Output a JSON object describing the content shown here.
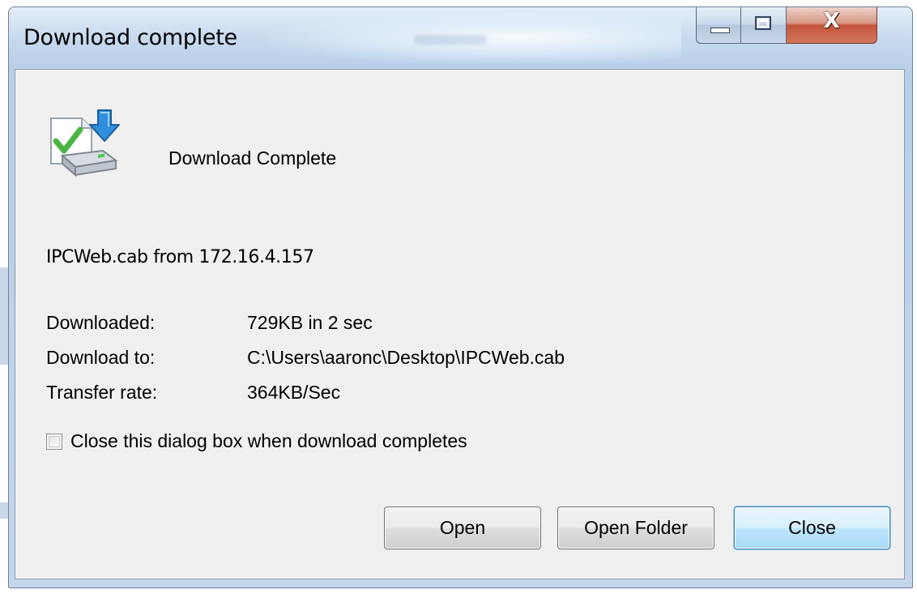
{
  "window": {
    "title": "Download complete",
    "controls": {
      "minimize": "minimize",
      "maximize": "maximize",
      "close_glyph": "X"
    }
  },
  "dialog": {
    "icon": "download-complete-icon",
    "heading": "Download Complete",
    "file_line": "IPCWeb.cab from 172.16.4.157",
    "details": [
      {
        "label": "Downloaded:",
        "value": "729KB in 2 sec"
      },
      {
        "label": "Download to:",
        "value": "C:\\Users\\aaronc\\Desktop\\IPCWeb.cab"
      },
      {
        "label": "Transfer rate:",
        "value": "364KB/Sec"
      }
    ],
    "checkbox": {
      "label": "Close this dialog box when download completes",
      "checked": false
    }
  },
  "buttons": {
    "open": "Open",
    "open_folder": "Open Folder",
    "close": "Close"
  },
  "colors": {
    "default_button_border": "#3c7fb1",
    "close_button_red": "#c4553b",
    "client_bg": "#f0f0f0"
  }
}
